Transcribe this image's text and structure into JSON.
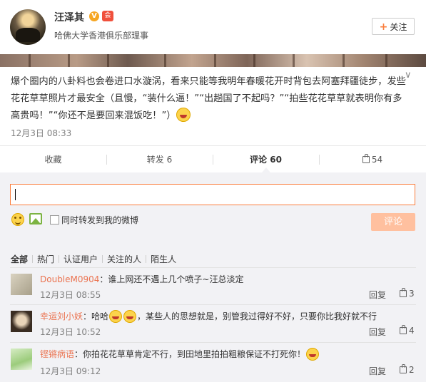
{
  "user": {
    "name": "汪泽其",
    "verified_badge": "V",
    "member_badge": "会",
    "subtitle": "哈佛大学香港俱乐部理事",
    "follow_label": "关注"
  },
  "post": {
    "text_1": "爆个圈内的八卦料也会卷进口水漩涡，看来只能等我明年春暖花开时背包去阿塞拜疆徒步，发些花花草草照片才最安全（且慢，“装什么逼！”“出趟国了不起吗？”“拍些花花草草就表明你有多高贵吗！”“你还不是要回来混饭吃！”）",
    "emoji": "laughing-emoji",
    "time": "12月3日 08:33"
  },
  "actions": {
    "favorite": "收藏",
    "repost": "转发 6",
    "comment": "评论 60",
    "like": "54"
  },
  "composer": {
    "value": "",
    "repost_checkbox_label": "同时转发到我的微博",
    "submit_label": "评论"
  },
  "filters": [
    "全部",
    "热门",
    "认证用户",
    "关注的人",
    "陌生人"
  ],
  "comments": [
    {
      "name": "DoubleM0904",
      "text": "：谁上网还不遇上几个喷子~汪总淡定",
      "time": "12月3日 08:55",
      "reply": "回复",
      "likes": "3"
    },
    {
      "name": "幸运刘小妖",
      "text_a": "：哈哈",
      "text_b": "，某些人的思想就是，别管我过得好不好，只要你比我好就不行",
      "time": "12月3日 10:52",
      "reply": "回复",
      "likes": "4"
    },
    {
      "name": "铿锵病语",
      "text": "：你拍花花草草肯定不行，到田地里拍拍粗粮保证不打死你！",
      "time": "12月3日 09:12",
      "reply": "回复",
      "likes": "2"
    }
  ],
  "colors": {
    "accent": "#fa7d3c",
    "comment_name": "#eb7350",
    "submit_disabled": "#ffc09f",
    "panel_bg": "#f2f2f5"
  }
}
